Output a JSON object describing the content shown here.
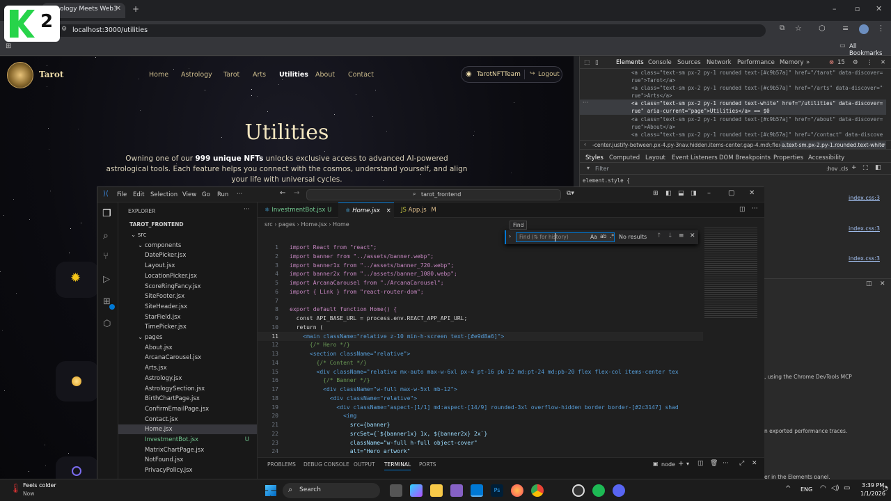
{
  "browser": {
    "tab_title": "ology Meets Web3",
    "url": "localhost:3000/utilities",
    "bookmarks_label": "All Bookmarks",
    "overlay_badge": "2"
  },
  "site": {
    "brand": "Tarot",
    "nav": [
      "Home",
      "Astrology",
      "Tarot",
      "Arts",
      "Utilities",
      "About",
      "Contact"
    ],
    "active_nav": "Utilities",
    "user_label": "TarotNFTTeam",
    "logout_label": "Logout",
    "heading": "Utilities",
    "para_before": "Owning one of our ",
    "para_bold": "999 unique NFTs",
    "para_after": " unlocks exclusive access to advanced AI-powered astrological tools. Each feature helps you connect with the cosmos, understand yourself, and align your life with universal cycles."
  },
  "vscode": {
    "menu": [
      "File",
      "Edit",
      "Selection",
      "View",
      "Go",
      "Run",
      "···"
    ],
    "search": "tarot_frontend",
    "explorer_title": "EXPLORER",
    "root": "TAROT_FRONTEND",
    "tree": [
      {
        "name": "src",
        "type": "folder",
        "indent": 1
      },
      {
        "name": "components",
        "type": "folder",
        "indent": 2
      },
      {
        "name": "DatePicker.jsx",
        "indent": 3
      },
      {
        "name": "Layout.jsx",
        "indent": 3
      },
      {
        "name": "LocationPicker.jsx",
        "indent": 3
      },
      {
        "name": "ScoreRingFancy.jsx",
        "indent": 3
      },
      {
        "name": "SiteFooter.jsx",
        "indent": 3
      },
      {
        "name": "SiteHeader.jsx",
        "indent": 3
      },
      {
        "name": "StarField.jsx",
        "indent": 3
      },
      {
        "name": "TimePicker.jsx",
        "indent": 3
      },
      {
        "name": "pages",
        "type": "folder",
        "indent": 2
      },
      {
        "name": "About.jsx",
        "indent": 3
      },
      {
        "name": "ArcanaCarousel.jsx",
        "indent": 3
      },
      {
        "name": "Arts.jsx",
        "indent": 3
      },
      {
        "name": "Astrology.jsx",
        "indent": 3
      },
      {
        "name": "AstrologySection.jsx",
        "indent": 3
      },
      {
        "name": "BirthChartPage.jsx",
        "indent": 3
      },
      {
        "name": "ConfirmEmailPage.jsx",
        "indent": 3
      },
      {
        "name": "Contact.jsx",
        "indent": 3
      },
      {
        "name": "Home.jsx",
        "indent": 3,
        "selected": true
      },
      {
        "name": "InvestmentBot.jsx",
        "indent": 3,
        "status": "U"
      },
      {
        "name": "MatrixChartPage.jsx",
        "indent": 3
      },
      {
        "name": "NotFound.jsx",
        "indent": 3
      },
      {
        "name": "PrivacyPolicy.jsx",
        "indent": 3
      }
    ],
    "tabs": [
      {
        "label": "InvestmentBot.jsx",
        "status": "U"
      },
      {
        "label": "Home.jsx",
        "status": "×",
        "active": true
      },
      {
        "label": "App.js",
        "status": "M"
      }
    ],
    "breadcrumb": [
      "src",
      "pages",
      "Home.jsx",
      "Home"
    ],
    "find": {
      "tooltip": "Find",
      "placeholder": "Find (⇅ for history)",
      "result": "No results",
      "aa": "Aa"
    },
    "code": [
      "import React from \"react\";",
      "import banner from \"../assets/banner.webp\";",
      "import banner1x from \"../assets/banner_720.webp\";",
      "import banner2x from \"../assets/banner_1080.webp\";",
      "import ArcanaCarousel from \"./ArcanaCarousel\";",
      "import { Link } from \"react-router-dom\";",
      "",
      "export default function Home() {",
      "  const API_BASE_URL = process.env.REACT_APP_API_URL;",
      "  return (",
      "    <main className=\"relative z-10 min-h-screen text-[#e9d8a6]\">",
      "      {/* Hero */}",
      "      <section className=\"relative\">",
      "        {/* Content */}",
      "        <div className=\"relative mx-auto max-w-6xl px-4 pt-16 pb-12 md:pt-24 md:pb-20 flex flex-col items-center tex",
      "          {/* Banner */}",
      "          <div className=\"w-full max-w-5xl mb-12\">",
      "            <div className=\"relative\">",
      "              <div className=\"aspect-[1/1] md:aspect-[14/9] rounded-3xl overflow-hidden border border-[#2c3147] shad",
      "                <img",
      "                  src={banner}",
      "                  srcSet={`${banner1x} 1x, ${banner2x} 2x`}",
      "                  className=\"w-full h-full object-cover\"",
      "                  alt=\"Hero artwork\""
    ],
    "current_line": 11,
    "panel_tabs": [
      "PROBLEMS",
      "DEBUG CONSOLE",
      "OUTPUT",
      "TERMINAL",
      "PORTS"
    ],
    "active_panel_tab": "TERMINAL",
    "terminal_label": "node"
  },
  "devtools": {
    "tabs": [
      "Elements",
      "Console",
      "Sources",
      "Network",
      "Performance",
      "Memory"
    ],
    "error_count": "15",
    "dom_lines": [
      "<a class=\"text-sm px-2 py-1 rounded text-[#c9b57a]\" href=\"/tarot\" data-discover=\"t",
      "rue\">Tarot</a>",
      "<a class=\"text-sm px-2 py-1 rounded text-[#c9b57a]\" href=\"/arts\" data-discover=\"t",
      "rue\">Arts</a>",
      "<a class=\"text-sm px-2 py-1 rounded text-white\" href=\"/utilities\" data-discover=\"t",
      "rue\" aria-current=\"page\">Utilities</a> == $0",
      "<a class=\"text-sm px-2 py-1 rounded text-[#c9b57a]\" href=\"/about\" data-discover=\"t",
      "rue\">About</a>",
      "<a class=\"text-sm px-2 py-1 rounded text-[#c9b57a]\" href=\"/contact\" data-discover=\"t"
    ],
    "crumbs": [
      "-center.justify-between.px-4.py-3",
      "nav.hidden.items-center.gap-4.md\\:flex",
      "a.text-sm.px-2.py-1.rounded.text-white"
    ],
    "subtabs": [
      "Styles",
      "Computed",
      "Layout",
      "Event Listeners",
      "DOM Breakpoints",
      "Properties",
      "Accessibility"
    ],
    "filter_placeholder": "Filter",
    "filter_right": ":hov .cls",
    "element_style": "element.style {",
    "css_links": [
      "index.css:3",
      "index.css:3",
      "index.css:3"
    ],
    "drawer_text1": ", using the Chrome DevTools MCP",
    "drawer_text2": "n exported performance traces.",
    "drawer_text3": "er in the Elements panel."
  },
  "taskbar": {
    "weather_line1": "Feels colder",
    "weather_line2": "Now",
    "search_label": "Search",
    "lang": "ENG",
    "time": "3:39 PM",
    "date": "1/1/2026"
  }
}
